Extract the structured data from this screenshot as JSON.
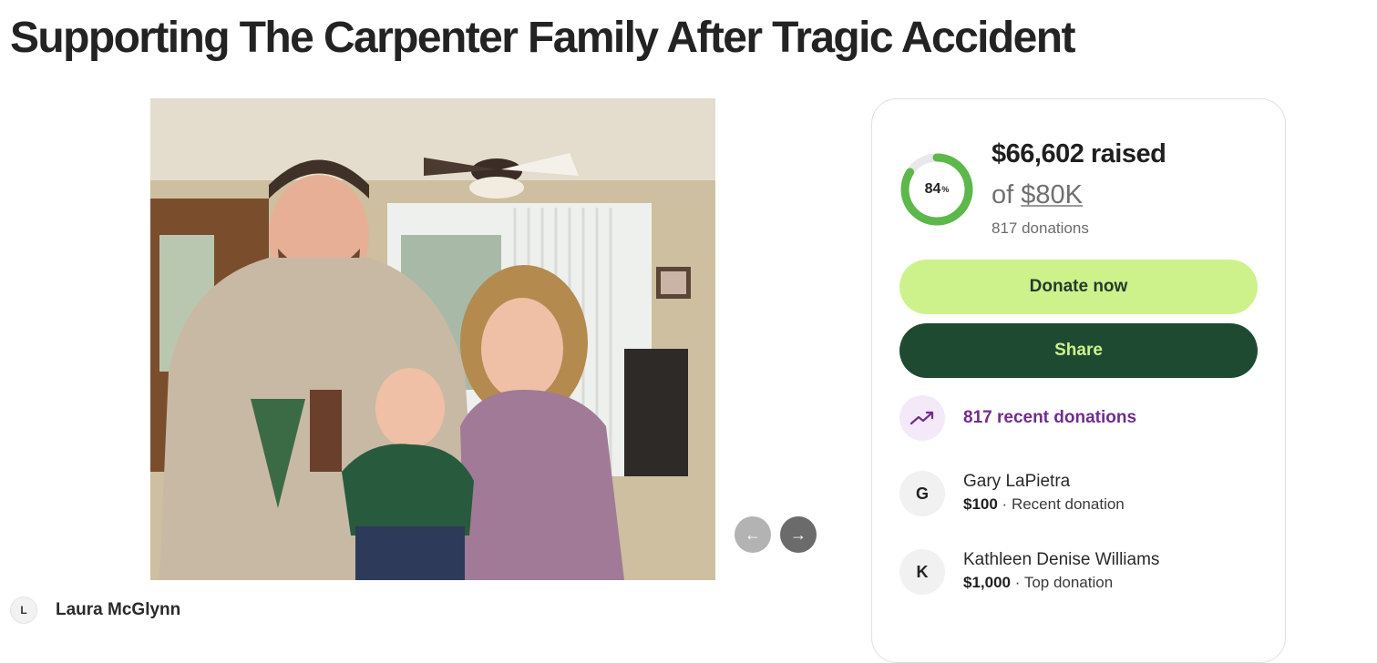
{
  "page": {
    "title": "Supporting The Carpenter Family After Tragic Accident"
  },
  "organizer": {
    "initial": "L",
    "name": "Laura McGlynn"
  },
  "carousel": {
    "prev_icon": "arrow-left-icon",
    "next_icon": "arrow-right-icon",
    "prev_glyph": "←",
    "next_glyph": "→"
  },
  "donation_card": {
    "progress_percent": 84,
    "progress_number": "84",
    "progress_unit": "%",
    "raised_text": "$66,602 raised",
    "goal_prefix": "of ",
    "goal_amount": "$80K",
    "donations_text": "817 donations",
    "donate_label": "Donate now",
    "share_label": "Share",
    "recent_label": "817 recent donations",
    "recent_icon": "trending-up-icon",
    "donors": [
      {
        "initial": "G",
        "name": "Gary LaPietra",
        "amount": "$100",
        "separator": " · ",
        "type": "Recent donation"
      },
      {
        "initial": "K",
        "name": "Kathleen Denise Williams",
        "amount": "$1,000",
        "separator": " · ",
        "type": "Top donation"
      }
    ]
  },
  "colors": {
    "progress_green": "#5cb84a",
    "progress_track": "#e8e8e8",
    "donate_bg": "#cdf28c",
    "share_bg": "#1f4a32",
    "recent_purple": "#6f2d8e"
  }
}
